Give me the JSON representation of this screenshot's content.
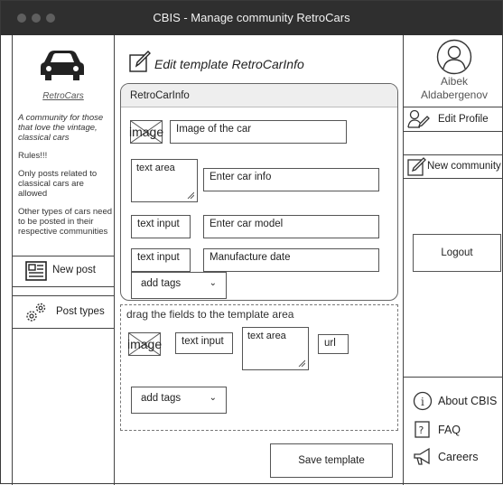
{
  "window": {
    "title": "CBIS - Manage community RetroCars"
  },
  "sidebar": {
    "community_name": "RetroCars",
    "description": "A community for those that love the vintage, classical cars",
    "rules_title": "Rules!!!",
    "rules": [
      "Only posts related to classical cars are allowed",
      "Other types of cars need to be posted in their respective communities"
    ],
    "new_post_label": "New post",
    "post_types_label": "Post types"
  },
  "main": {
    "page_title": "Edit template RetroCarInfo",
    "template": {
      "name": "RetroCarInfo",
      "fields": {
        "image_label": "image",
        "image_name": "Image of the car",
        "textarea_label": "text area",
        "textarea_name": "Enter car info",
        "model_label": "text input",
        "model_name": "Enter car model",
        "date_label": "text input",
        "date_name": "Manufacture date",
        "tags_label": "add tags"
      }
    },
    "palette": {
      "caption": "drag the fields to the template area",
      "image_label": "image",
      "text_input_label": "text input",
      "text_area_label": "text area",
      "url_label": "url",
      "tags_label": "add tags"
    },
    "save_label": "Save template"
  },
  "right_panel": {
    "user_first": "Aibek",
    "user_last": "Aldabergenov",
    "edit_profile_label": "Edit Profile",
    "new_community_label": "New community",
    "logout_label": "Logout",
    "about_label": "About CBIS",
    "faq_label": "FAQ",
    "careers_label": "Careers"
  },
  "icons": {
    "car": "car-icon",
    "edit": "pencil-icon",
    "avatar": "user-avatar-icon",
    "newspaper": "newspaper-icon",
    "gears": "gears-icon",
    "info": "info-icon",
    "faq": "question-icon",
    "megaphone": "megaphone-icon"
  },
  "colors": {
    "titlebar": "#2f2f2f",
    "border": "#444444",
    "panel_header": "#eeeeee"
  }
}
